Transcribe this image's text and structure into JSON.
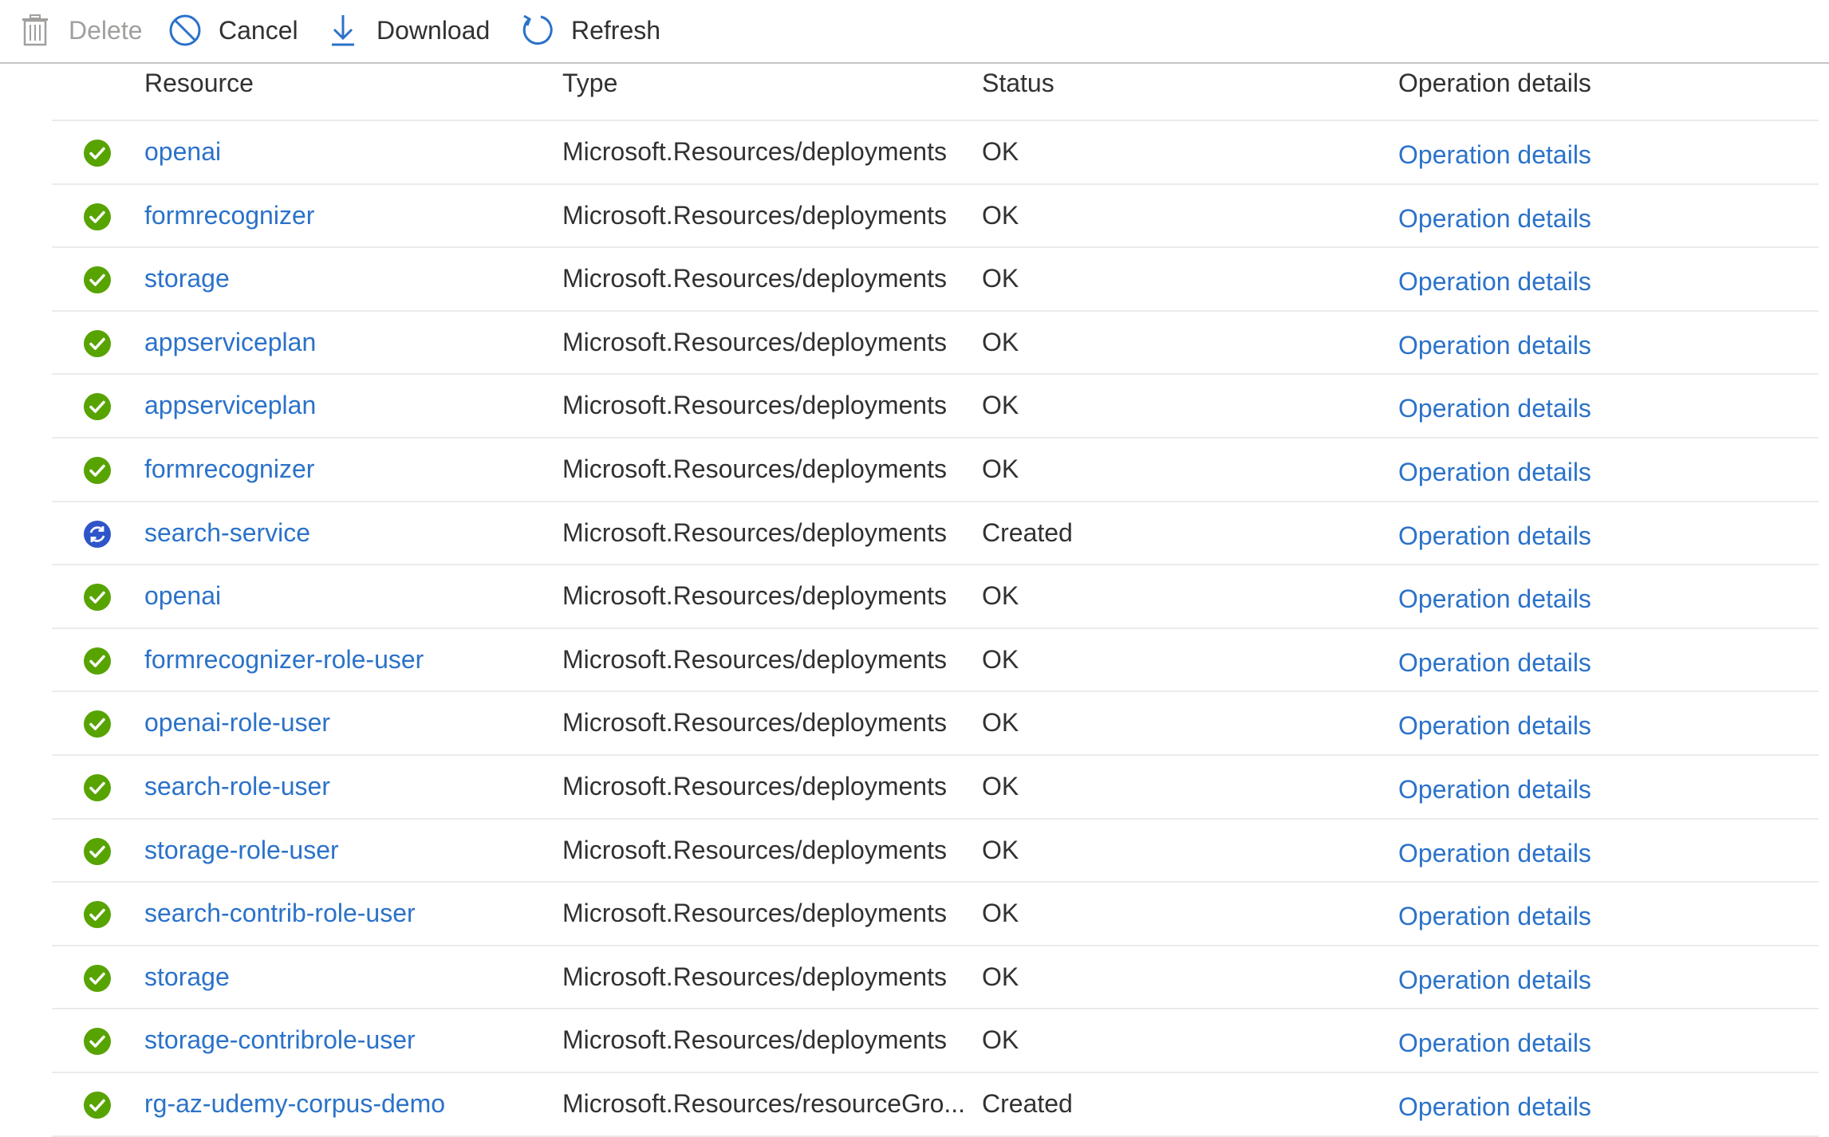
{
  "toolbar": {
    "delete_label": "Delete",
    "cancel_label": "Cancel",
    "download_label": "Download",
    "refresh_label": "Refresh"
  },
  "table": {
    "headers": {
      "resource": "Resource",
      "type": "Type",
      "status": "Status",
      "operation_details": "Operation details"
    },
    "rows": [
      {
        "icon": "success-check-icon",
        "resource": "openai",
        "type": "Microsoft.Resources/deployments",
        "status": "OK",
        "details": "Operation details"
      },
      {
        "icon": "success-check-icon",
        "resource": "formrecognizer",
        "type": "Microsoft.Resources/deployments",
        "status": "OK",
        "details": "Operation details"
      },
      {
        "icon": "success-check-icon",
        "resource": "storage",
        "type": "Microsoft.Resources/deployments",
        "status": "OK",
        "details": "Operation details"
      },
      {
        "icon": "success-check-icon",
        "resource": "appserviceplan",
        "type": "Microsoft.Resources/deployments",
        "status": "OK",
        "details": "Operation details"
      },
      {
        "icon": "success-check-icon",
        "resource": "appserviceplan",
        "type": "Microsoft.Resources/deployments",
        "status": "OK",
        "details": "Operation details"
      },
      {
        "icon": "success-check-icon",
        "resource": "formrecognizer",
        "type": "Microsoft.Resources/deployments",
        "status": "OK",
        "details": "Operation details"
      },
      {
        "icon": "in-progress-sync-icon",
        "resource": "search-service",
        "type": "Microsoft.Resources/deployments",
        "status": "Created",
        "details": "Operation details"
      },
      {
        "icon": "success-check-icon",
        "resource": "openai",
        "type": "Microsoft.Resources/deployments",
        "status": "OK",
        "details": "Operation details"
      },
      {
        "icon": "success-check-icon",
        "resource": "formrecognizer-role-user",
        "type": "Microsoft.Resources/deployments",
        "status": "OK",
        "details": "Operation details"
      },
      {
        "icon": "success-check-icon",
        "resource": "openai-role-user",
        "type": "Microsoft.Resources/deployments",
        "status": "OK",
        "details": "Operation details"
      },
      {
        "icon": "success-check-icon",
        "resource": "search-role-user",
        "type": "Microsoft.Resources/deployments",
        "status": "OK",
        "details": "Operation details"
      },
      {
        "icon": "success-check-icon",
        "resource": "storage-role-user",
        "type": "Microsoft.Resources/deployments",
        "status": "OK",
        "details": "Operation details"
      },
      {
        "icon": "success-check-icon",
        "resource": "search-contrib-role-user",
        "type": "Microsoft.Resources/deployments",
        "status": "OK",
        "details": "Operation details"
      },
      {
        "icon": "success-check-icon",
        "resource": "storage",
        "type": "Microsoft.Resources/deployments",
        "status": "OK",
        "details": "Operation details"
      },
      {
        "icon": "success-check-icon",
        "resource": "storage-contribrole-user",
        "type": "Microsoft.Resources/deployments",
        "status": "OK",
        "details": "Operation details"
      },
      {
        "icon": "success-check-icon",
        "resource": "rg-az-udemy-corpus-demo",
        "type": "Microsoft.Resources/resourceGro...",
        "status": "Created",
        "details": "Operation details"
      }
    ]
  },
  "colors": {
    "link": "#2b72c9",
    "success": "#57a300",
    "in_progress": "#2f55c9",
    "text": "#323130",
    "disabled": "#a19f9d"
  }
}
